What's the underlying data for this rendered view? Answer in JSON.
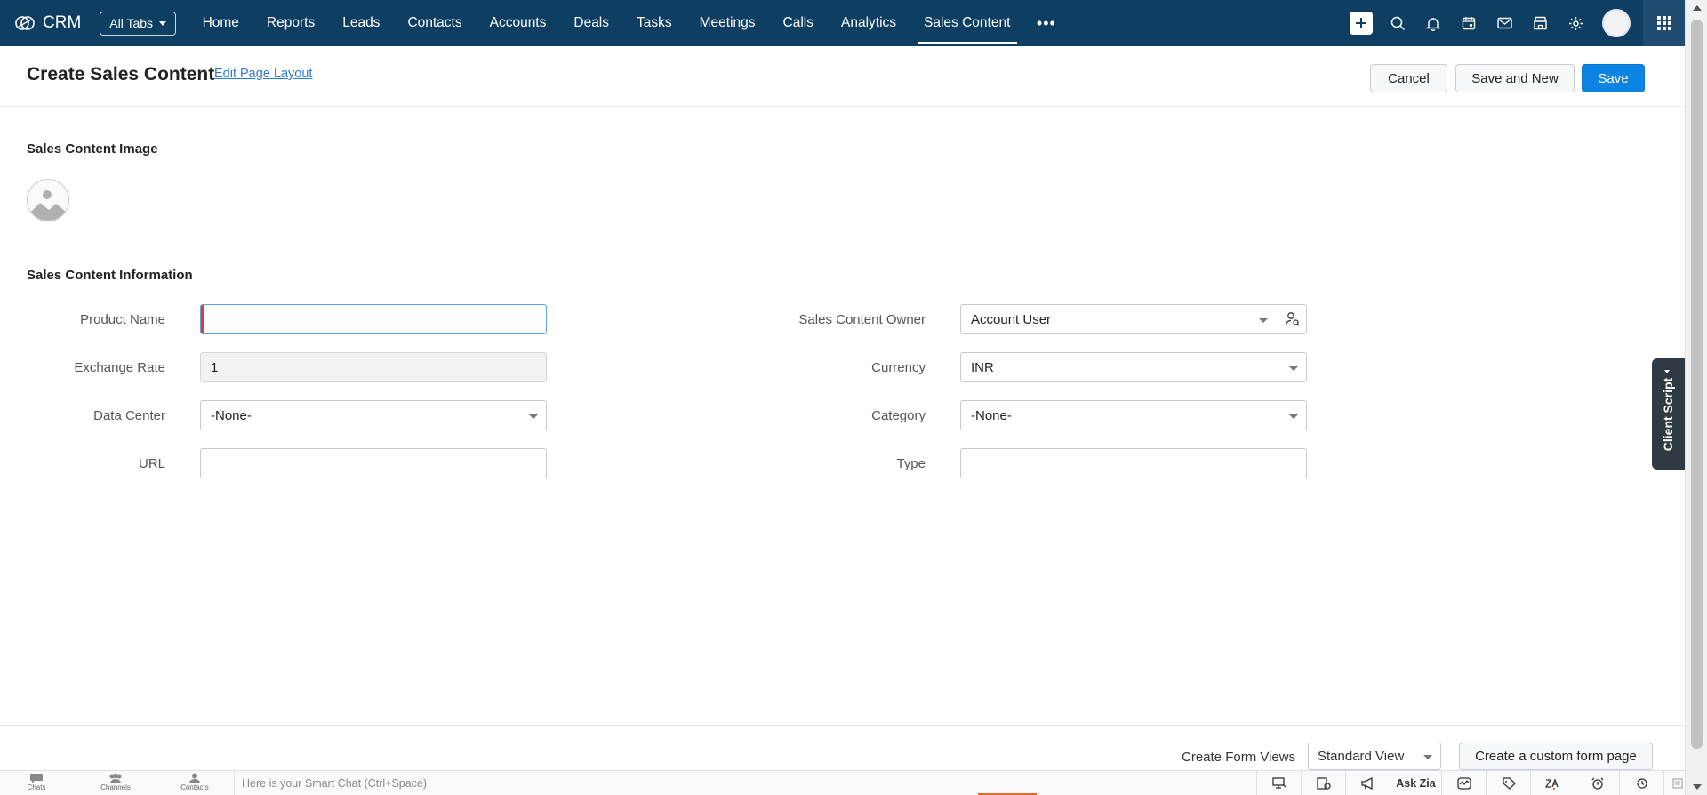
{
  "brand": {
    "name": "CRM"
  },
  "nav": {
    "all_tabs": "All Tabs",
    "tabs": [
      {
        "label": "Home"
      },
      {
        "label": "Reports"
      },
      {
        "label": "Leads"
      },
      {
        "label": "Contacts"
      },
      {
        "label": "Accounts"
      },
      {
        "label": "Deals"
      },
      {
        "label": "Tasks"
      },
      {
        "label": "Meetings"
      },
      {
        "label": "Calls"
      },
      {
        "label": "Analytics"
      },
      {
        "label": "Sales Content"
      }
    ],
    "active_tab": "Sales Content",
    "more": "•••"
  },
  "header": {
    "title": "Create Sales Content",
    "edit_layout": "Edit Page Layout",
    "cancel": "Cancel",
    "save_and_new": "Save and New",
    "save": "Save"
  },
  "sections": {
    "image": "Sales Content Image",
    "info": "Sales Content Information"
  },
  "fields": {
    "product_name": {
      "label": "Product Name",
      "value": ""
    },
    "exchange_rate": {
      "label": "Exchange Rate",
      "value": "1"
    },
    "data_center": {
      "label": "Data Center",
      "value": "-None-"
    },
    "url": {
      "label": "URL",
      "value": ""
    },
    "owner": {
      "label": "Sales Content Owner",
      "value": "Account User"
    },
    "currency": {
      "label": "Currency",
      "value": "INR"
    },
    "category": {
      "label": "Category",
      "value": "-None-"
    },
    "type": {
      "label": "Type",
      "value": ""
    }
  },
  "client_script": "Client Script",
  "footer": {
    "create_form_views": "Create Form Views",
    "standard_view": "Standard View",
    "custom_form_page": "Create a custom form page"
  },
  "chatbar": {
    "chats": "Chats",
    "channels": "Channels",
    "contacts": "Contacts",
    "smart_chat_placeholder": "Here is your Smart Chat (Ctrl+Space)",
    "ask_zia": "Ask Zia"
  },
  "colors": {
    "topbar": "#0f3e63",
    "primary_button": "#0c84e4",
    "link": "#2c7bd6",
    "mandatory": "#e0383e"
  }
}
